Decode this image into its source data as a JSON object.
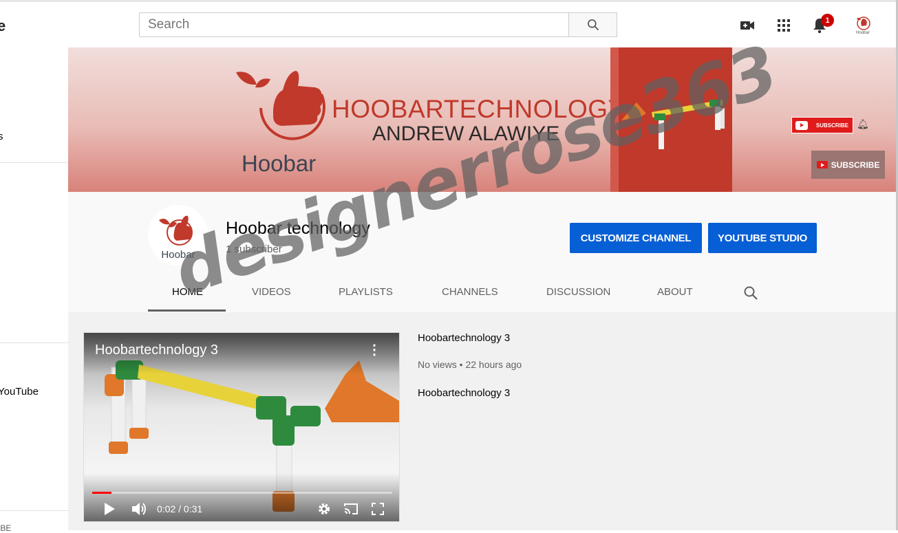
{
  "masthead": {
    "logo_fragment": "e",
    "search": {
      "placeholder": "Search",
      "value": ""
    },
    "icons": [
      "search-icon",
      "create-video-icon",
      "apps-grid-icon",
      "bell-icon"
    ],
    "notification_count": "1",
    "avatar_label": "Hoobar"
  },
  "sidebar": {
    "fragments": [
      "s",
      "YouTube",
      "IBE"
    ]
  },
  "banner": {
    "brand_name": "Hoobar",
    "title": "HOOBARTECHNOLOGY",
    "subtitle": "ANDREW ALAWIYE",
    "mini_subscribe_label": "SUBSCRIBE",
    "subscribe_label": "SUBSCRIBE"
  },
  "channel": {
    "avatar_label": "Hoobar",
    "name": "Hoobar technology",
    "subscribers": "1 subscriber",
    "buttons": {
      "customize": "CUSTOMIZE CHANNEL",
      "studio": "YOUTUBE STUDIO"
    },
    "tabs": [
      {
        "label": "HOME",
        "active": true
      },
      {
        "label": "VIDEOS",
        "active": false
      },
      {
        "label": "PLAYLISTS",
        "active": false
      },
      {
        "label": "CHANNELS",
        "active": false
      },
      {
        "label": "DISCUSSION",
        "active": false
      },
      {
        "label": "ABOUT",
        "active": false
      }
    ]
  },
  "featured_video": {
    "player_title": "Hoobartechnology 3",
    "current_time": "0:02",
    "duration": "0:31",
    "time_display": "0:02 / 0:31",
    "progress_fraction": 0.065,
    "title": "Hoobartechnology 3",
    "meta": "No views • 22 hours ago",
    "description": "Hoobartechnology 3"
  },
  "watermark": "designerrose363",
  "colors": {
    "brand_red": "#c0392b",
    "button_blue": "#065fd4",
    "youtube_red": "#ff0000"
  }
}
